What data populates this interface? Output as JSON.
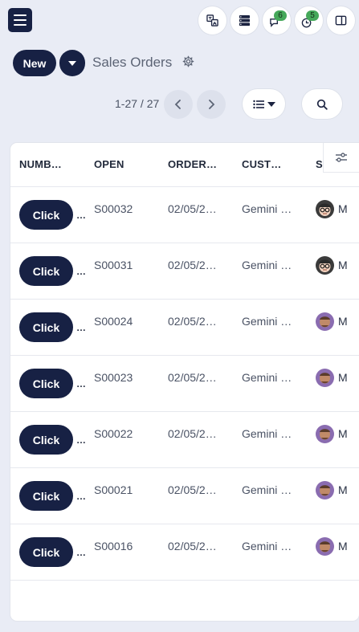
{
  "topbar": {
    "menu_icon": "hamburger-icon",
    "buttons": [
      {
        "name": "translate-icon",
        "badge": null
      },
      {
        "name": "database-icon",
        "badge": null
      },
      {
        "name": "chat-icon",
        "badge": "6"
      },
      {
        "name": "activity-clock-icon",
        "badge": "5"
      },
      {
        "name": "split-panel-icon",
        "badge": null
      }
    ],
    "badge_color": "#45a85a"
  },
  "control": {
    "new_label": "New",
    "title": "Sales Orders",
    "pager": "1-27 / 27",
    "accent": "#172144"
  },
  "table": {
    "headers": [
      "NUMB…",
      "OPEN",
      "ORDER…",
      "CUST…",
      "S…"
    ],
    "rows": [
      {
        "action": "Click",
        "more": "…",
        "open": "S00032",
        "order_date": "02/05/2…",
        "customer": "Gemini …",
        "salesperson": "M",
        "avatar": "glasses"
      },
      {
        "action": "Click",
        "more": "…",
        "open": "S00031",
        "order_date": "02/05/2…",
        "customer": "Gemini …",
        "salesperson": "M",
        "avatar": "glasses"
      },
      {
        "action": "Click",
        "more": "…",
        "open": "S00024",
        "order_date": "02/05/2…",
        "customer": "Gemini …",
        "salesperson": "M",
        "avatar": "purple"
      },
      {
        "action": "Click",
        "more": "…",
        "open": "S00023",
        "order_date": "02/05/2…",
        "customer": "Gemini …",
        "salesperson": "M",
        "avatar": "purple"
      },
      {
        "action": "Click",
        "more": "…",
        "open": "S00022",
        "order_date": "02/05/2…",
        "customer": "Gemini …",
        "salesperson": "M",
        "avatar": "purple"
      },
      {
        "action": "Click",
        "more": "…",
        "open": "S00021",
        "order_date": "02/05/2…",
        "customer": "Gemini …",
        "salesperson": "M",
        "avatar": "purple"
      },
      {
        "action": "Click",
        "more": "…",
        "open": "S00016",
        "order_date": "02/05/2…",
        "customer": "Gemini …",
        "salesperson": "M",
        "avatar": "purple"
      }
    ]
  }
}
